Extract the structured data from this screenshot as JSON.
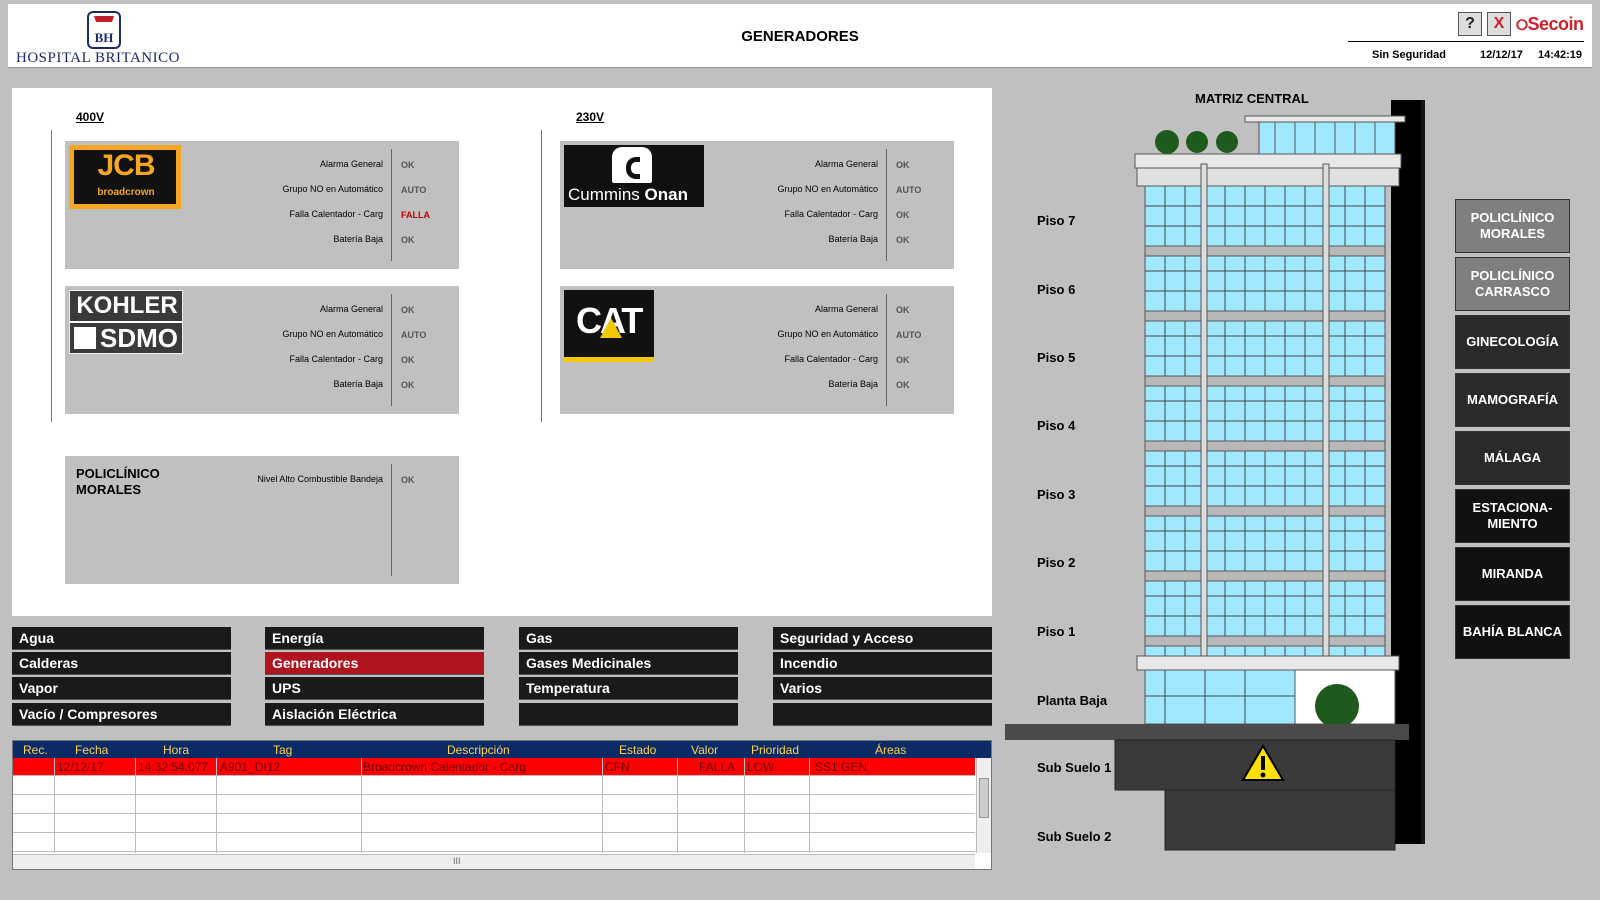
{
  "header": {
    "logo_initials": "BH",
    "hospital_name": "HOSPITAL BRITANICO",
    "title": "GENERADORES",
    "help_label": "?",
    "close_label": "X",
    "brand": "Secoin",
    "security": "Sin Seguridad",
    "date": "12/12/17",
    "time": "14:42:19"
  },
  "panel": {
    "v400": "400V",
    "v230": "230V",
    "generators": [
      {
        "brand": "JCB broadcrown",
        "rows": [
          {
            "label": "Alarma General",
            "value": "OK"
          },
          {
            "label": "Grupo NO en Automático",
            "value": "AUTO"
          },
          {
            "label": "Falla Calentador - Carg",
            "value": "FALLA"
          },
          {
            "label": "Batería Baja",
            "value": "OK"
          }
        ]
      },
      {
        "brand": "KOHLER SDMO",
        "rows": [
          {
            "label": "Alarma General",
            "value": "OK"
          },
          {
            "label": "Grupo NO en Automático",
            "value": "AUTO"
          },
          {
            "label": "Falla Calentador - Carg",
            "value": "OK"
          },
          {
            "label": "Batería Baja",
            "value": "OK"
          }
        ]
      },
      {
        "brand": "Cummins Onan",
        "rows": [
          {
            "label": "Alarma General",
            "value": "OK"
          },
          {
            "label": "Grupo NO en Automático",
            "value": "AUTO"
          },
          {
            "label": "Falla Calentador - Carg",
            "value": "OK"
          },
          {
            "label": "Batería Baja",
            "value": "OK"
          }
        ]
      },
      {
        "brand": "CAT",
        "rows": [
          {
            "label": "Alarma General",
            "value": "OK"
          },
          {
            "label": "Grupo NO en Automático",
            "value": "AUTO"
          },
          {
            "label": "Falla Calentador - Carg",
            "value": "OK"
          },
          {
            "label": "Batería Baja",
            "value": "OK"
          }
        ]
      }
    ],
    "brand_text": {
      "jcb": "JCB",
      "broadcrown": "broadcrown",
      "kohler": "KOHLER",
      "sdmo": "SDMO",
      "cummins": "Cummins",
      "onan": "Onan",
      "cat": "CAT"
    },
    "morales": {
      "title": "POLICLÍNICO MORALES",
      "label": "Nivel Alto Combustible Bandeja",
      "value": "OK"
    }
  },
  "nav": [
    [
      "Agua",
      "Calderas",
      "Vapor",
      "Vacío / Compresores"
    ],
    [
      "Energía",
      "Generadores",
      "UPS",
      "Aislación Eléctrica"
    ],
    [
      "Gas",
      "Gases Medicinales",
      "Temperatura",
      ""
    ],
    [
      "Seguridad y Acceso",
      "Incendio",
      "Varios",
      ""
    ]
  ],
  "alarms": {
    "headers": [
      "Rec.",
      "Fecha",
      "Hora",
      "Tag",
      "Descripción",
      "Estado",
      "Valor",
      "Prioridad",
      "Áreas"
    ],
    "rows": [
      {
        "rec": "",
        "fecha": "12/12/17",
        "hora": "14:32:54.077",
        "tag": "A901_DI12",
        "descripcion": "Broadcrown Calentador - Carg",
        "estado": "CFN",
        "valor": "FALLA",
        "prioridad": "LOW",
        "areas": "SS1 GEN"
      }
    ],
    "scroll_grip": "III"
  },
  "building": {
    "title": "MATRIZ CENTRAL",
    "floors": [
      "Piso 7",
      "Piso 6",
      "Piso 5",
      "Piso 4",
      "Piso 3",
      "Piso 2",
      "Piso 1",
      "Planta Baja",
      "Sub Suelo 1",
      "Sub Suelo 2"
    ]
  },
  "side_buttons": [
    {
      "label": "POLICLÍNICO MORALES",
      "style": "light"
    },
    {
      "label": "POLICLÍNICO CARRASCO",
      "style": "light"
    },
    {
      "label": "GINECOLOGÍA",
      "style": "dark"
    },
    {
      "label": "MAMOGRAFÍA",
      "style": "dark"
    },
    {
      "label": "MÁLAGA",
      "style": "dark"
    },
    {
      "label": "ESTACIONA- MIENTO",
      "style": "black"
    },
    {
      "label": "MIRANDA",
      "style": "black"
    },
    {
      "label": "BAHÍA BLANCA",
      "style": "black"
    }
  ],
  "colors": {
    "active_nav": "#b0141e",
    "alarm_row": "#ff0000",
    "alarm_header": "#0c2a66",
    "glass": "#9fe8ff",
    "warning": "#ffe000"
  }
}
